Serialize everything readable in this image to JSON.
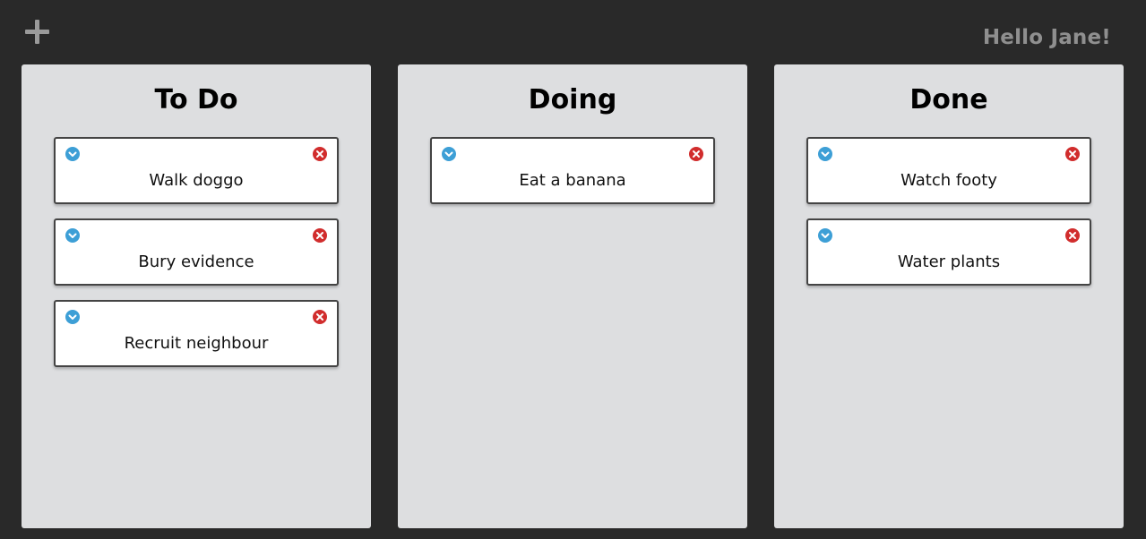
{
  "header": {
    "add_icon": "plus-icon",
    "greeting": "Hello Jane!"
  },
  "columns": [
    {
      "title": "To Do",
      "cards": [
        {
          "text": "Walk doggo"
        },
        {
          "text": "Bury evidence"
        },
        {
          "text": "Recruit neighbour"
        }
      ]
    },
    {
      "title": "Doing",
      "cards": [
        {
          "text": "Eat a banana"
        }
      ]
    },
    {
      "title": "Done",
      "cards": [
        {
          "text": "Watch footy"
        },
        {
          "text": "Water plants"
        }
      ]
    }
  ],
  "icons": {
    "expand": "chevron-down-icon",
    "delete": "close-icon"
  },
  "colors": {
    "background": "#292929",
    "column": "#dddee0",
    "expand": "#3d9fd6",
    "delete": "#d12d2d",
    "greeting": "#8f8f8f"
  }
}
